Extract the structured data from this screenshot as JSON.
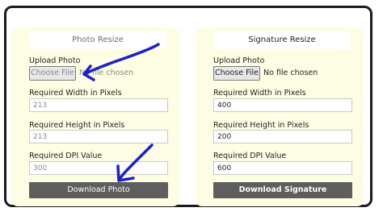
{
  "photo_panel": {
    "title": "Photo Resize",
    "upload_label": "Upload Photo",
    "choose_file_label": "Choose File",
    "file_status": "No file chosen",
    "width_label": "Required Width in Pixels",
    "width_value": "213",
    "height_label": "Required Height in Pixels",
    "height_value": "213",
    "dpi_label": "Required DPI Value",
    "dpi_value": "300",
    "download_label": "Download Photo"
  },
  "signature_panel": {
    "title": "Signature Resize",
    "upload_label": "Upload Photo",
    "choose_file_label": "Choose File",
    "file_status": "No file chosen",
    "width_label": "Required Width in Pixels",
    "width_value": "400",
    "height_label": "Required Height in Pixels",
    "height_value": "200",
    "dpi_label": "Required DPI Value",
    "dpi_value": "600",
    "download_label": "Download Signature"
  },
  "colors": {
    "panel_background": "#fdfde3",
    "button_background": "#5e5e5e",
    "annotation_arrow": "#1d21c9"
  }
}
